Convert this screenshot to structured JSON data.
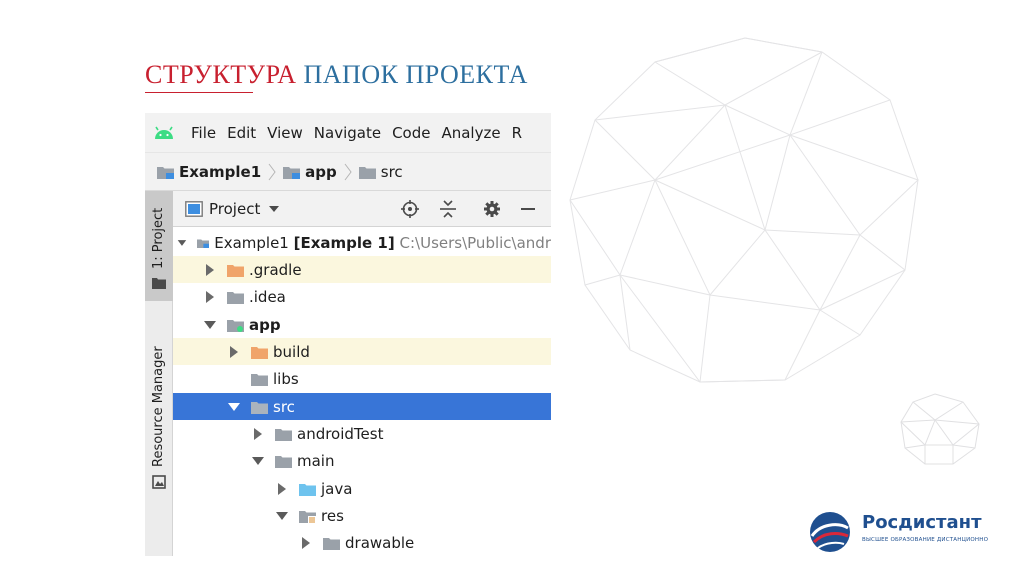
{
  "slide": {
    "title_red": "СТРУКТУРА",
    "title_blue": "ПАПОК ПРОЕКТА"
  },
  "menu": {
    "items": [
      "File",
      "Edit",
      "View",
      "Navigate",
      "Code",
      "Analyze",
      "R"
    ]
  },
  "breadcrumb": {
    "items": [
      "Example1",
      "app",
      "src"
    ]
  },
  "side_tabs": {
    "project": "1: Project",
    "resource_manager": "Resource Manager"
  },
  "panel": {
    "view_label": "Project"
  },
  "tree": [
    {
      "name": "Example1",
      "bold_suffix": "[Example 1]",
      "path": "C:\\Users\\Public\\andr",
      "indent": 0,
      "expanded": true,
      "icon": "module-folder-icon",
      "highlight": false,
      "selected": false
    },
    {
      "name": ".gradle",
      "indent": 1,
      "expanded": false,
      "icon": "excluded-folder-icon",
      "highlight": true,
      "selected": false
    },
    {
      "name": ".idea",
      "indent": 1,
      "expanded": false,
      "icon": "folder-icon",
      "highlight": false,
      "selected": false
    },
    {
      "name": "app",
      "indent": 1,
      "expanded": true,
      "icon": "android-module-folder-icon",
      "highlight": false,
      "selected": false,
      "bold": true
    },
    {
      "name": "build",
      "indent": 2,
      "expanded": false,
      "icon": "excluded-folder-icon",
      "highlight": true,
      "selected": false
    },
    {
      "name": "libs",
      "indent": 2,
      "expanded": null,
      "icon": "folder-icon",
      "highlight": false,
      "selected": false
    },
    {
      "name": "src",
      "indent": 2,
      "expanded": true,
      "icon": "folder-icon",
      "highlight": false,
      "selected": true
    },
    {
      "name": "androidTest",
      "indent": 3,
      "expanded": false,
      "icon": "folder-icon",
      "highlight": false,
      "selected": false
    },
    {
      "name": "main",
      "indent": 3,
      "expanded": true,
      "icon": "folder-icon",
      "highlight": false,
      "selected": false
    },
    {
      "name": "java",
      "indent": 4,
      "expanded": false,
      "icon": "source-folder-icon",
      "highlight": false,
      "selected": false
    },
    {
      "name": "res",
      "indent": 4,
      "expanded": true,
      "icon": "resource-folder-icon",
      "highlight": false,
      "selected": false
    },
    {
      "name": "drawable",
      "indent": 5,
      "expanded": false,
      "icon": "folder-icon",
      "highlight": false,
      "selected": false
    }
  ],
  "logo": {
    "name": "Росдистант",
    "tagline": "ВЫСШЕЕ ОБРАЗОВАНИЕ ДИСТАНЦИОННО"
  },
  "colors": {
    "title_red": "#c8202f",
    "title_blue": "#2d6f9f",
    "selection": "#3875d7",
    "excluded_folder": "#f0a46a",
    "source_folder": "#6ec3ee",
    "folder": "#9aa1a9",
    "android": "#3ddc84",
    "highlight_row": "#fbf7de"
  }
}
